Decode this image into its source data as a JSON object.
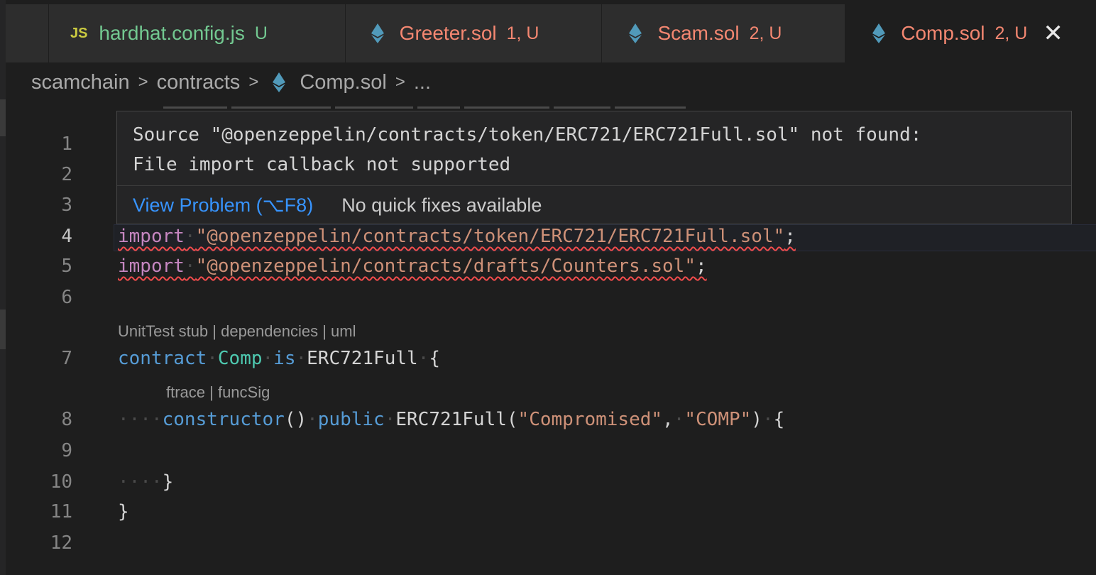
{
  "tabs": [
    {
      "icon": "JS",
      "name": "hardhat.config.js",
      "status": "U",
      "name_color": "#73c991",
      "status_color": "#73c991"
    },
    {
      "icon": "eth",
      "name": "Greeter.sol",
      "status": "1, U",
      "name_color": "#f48771",
      "status_color": "#f48771"
    },
    {
      "icon": "eth",
      "name": "Scam.sol",
      "status": "2, U",
      "name_color": "#f48771",
      "status_color": "#f48771"
    },
    {
      "icon": "eth",
      "name": "Comp.sol",
      "status": "2, U",
      "name_color": "#f48771",
      "status_color": "#f48771",
      "active": true,
      "close": "✕"
    }
  ],
  "breadcrumb": {
    "folder1": "scamchain",
    "folder2": "contracts",
    "file": "Comp.sol",
    "more": "...",
    "separator": ">"
  },
  "hover": {
    "message_line1": "Source \"@openzeppelin/contracts/token/ERC721/ERC721Full.sol\" not found:",
    "message_line2": "File import callback not supported",
    "view_problem": "View Problem (⌥F8)",
    "no_fixes": "No quick fixes available"
  },
  "editor": {
    "line_numbers": [
      "1",
      "2",
      "3",
      "4",
      "5",
      "6",
      "7",
      "8",
      "9",
      "10",
      "11",
      "12"
    ],
    "current_line": "4",
    "lens_contract": "UnitTest stub | dependencies | uml",
    "lens_constructor": "ftrace | funcSig",
    "code": {
      "l4_kw": "import",
      "l4_str": "\"@openzeppelin/contracts/token/ERC721/ERC721Full.sol\"",
      "l4_end": ";",
      "l5_kw": "import",
      "l5_str": "\"@openzeppelin/contracts/drafts/Counters.sol\"",
      "l5_end": ";",
      "l7_kw": "contract",
      "l7_name": "Comp",
      "l7_is": "is",
      "l7_base": "ERC721Full",
      "l7_brace": "{",
      "l8_ctor": "constructor",
      "l8_parens": "()",
      "l8_public": "public",
      "l8_base": "ERC721Full(",
      "l8_arg1": "\"Compromised\"",
      "l8_comma": ",",
      "l8_arg2": "\"COMP\"",
      "l8_close": ")",
      "l8_brace": "{",
      "l10_brace": "}",
      "l11_brace": "}"
    }
  },
  "colors": {
    "background": "#1e1e1e",
    "error_squiggle": "#f14c4c",
    "link": "#3794ff"
  }
}
